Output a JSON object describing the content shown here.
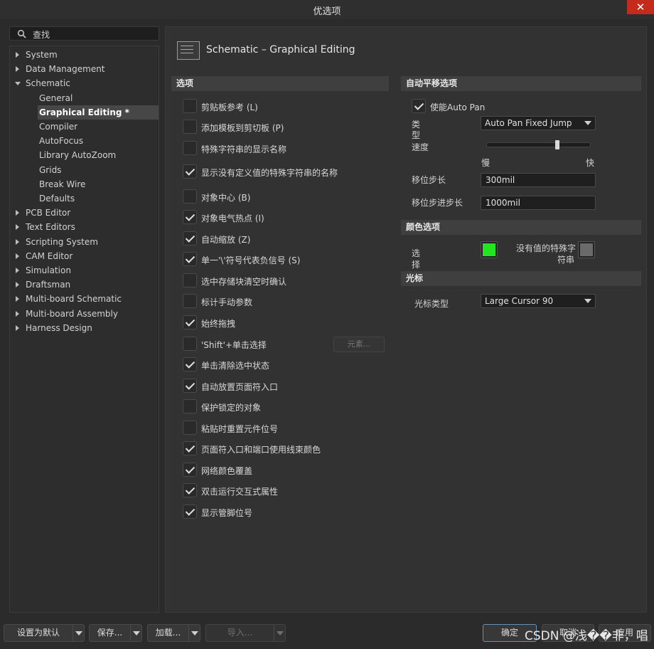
{
  "window": {
    "title": "优选项",
    "close_glyph": "✕"
  },
  "search": {
    "placeholder": "查找"
  },
  "tree": {
    "items": [
      {
        "label": "System",
        "expanded": false
      },
      {
        "label": "Data Management",
        "expanded": false
      },
      {
        "label": "Schematic",
        "expanded": true
      },
      {
        "label": "General",
        "child": true
      },
      {
        "label": "Graphical Editing *",
        "child": true,
        "selected": true
      },
      {
        "label": "Compiler",
        "child": true
      },
      {
        "label": "AutoFocus",
        "child": true
      },
      {
        "label": "Library AutoZoom",
        "child": true
      },
      {
        "label": "Grids",
        "child": true
      },
      {
        "label": "Break Wire",
        "child": true
      },
      {
        "label": "Defaults",
        "child": true
      },
      {
        "label": "PCB Editor",
        "expanded": false
      },
      {
        "label": "Text Editors",
        "expanded": false
      },
      {
        "label": "Scripting System",
        "expanded": false
      },
      {
        "label": "CAM Editor",
        "expanded": false
      },
      {
        "label": "Simulation",
        "expanded": false
      },
      {
        "label": "Draftsman",
        "expanded": false
      },
      {
        "label": "Multi-board Schematic",
        "expanded": false
      },
      {
        "label": "Multi-board Assembly",
        "expanded": false
      },
      {
        "label": "Harness Design",
        "expanded": false
      }
    ]
  },
  "page": {
    "title": "Schematic – Graphical Editing"
  },
  "options": {
    "header": "选项",
    "items": [
      {
        "label": "剪贴板参考 (L)",
        "checked": false
      },
      {
        "label": "添加模板到剪切板 (P)",
        "checked": false
      },
      {
        "label": "特殊字符串的显示名称",
        "checked": false
      },
      {
        "label": "显示没有定义值的特殊字符串的名称",
        "checked": true
      },
      {
        "label": "对象中心 (B)",
        "checked": false
      },
      {
        "label": "对象电气热点 (I)",
        "checked": true
      },
      {
        "label": "自动缩放 (Z)",
        "checked": true
      },
      {
        "label": "单一'\\'符号代表负信号 (S)",
        "checked": true
      },
      {
        "label": "选中存储块清空时确认",
        "checked": false
      },
      {
        "label": "标计手动参数",
        "checked": false
      },
      {
        "label": "始终拖拽",
        "checked": true
      },
      {
        "label": "'Shift'+单击选择",
        "checked": false
      },
      {
        "label": "单击清除选中状态",
        "checked": true
      },
      {
        "label": "自动放置页面符入口",
        "checked": true
      },
      {
        "label": "保护锁定的对象",
        "checked": false
      },
      {
        "label": "粘贴时重置元件位号",
        "checked": false
      },
      {
        "label": "页面符入口和端口使用线束颜色",
        "checked": true
      },
      {
        "label": "网络颜色覆盖",
        "checked": true
      },
      {
        "label": "双击运行交互式属性",
        "checked": true
      },
      {
        "label": "显示管脚位号",
        "checked": true
      }
    ],
    "elements_button": "元素..."
  },
  "autopan": {
    "header": "自动平移选项",
    "enable_label": "使能Auto Pan",
    "enable_checked": true,
    "type_label": "类\n型",
    "type_label_top": "类",
    "type_label_bottom": "型",
    "type_value": "Auto Pan Fixed Jump",
    "speed_label": "速度",
    "speed_slow": "慢",
    "speed_fast": "快",
    "speed_level_fraction": 0.68,
    "step_label": "移位步长",
    "step_value": "300mil",
    "shift_step_label": "移位步进步长",
    "shift_step_value": "1000mil"
  },
  "colors": {
    "header": "颜色选项",
    "select_top": "选",
    "select_bottom": "择",
    "select_color": "#22e622",
    "nostr_line1": "没有值的特殊字",
    "nostr_line2": "符串",
    "nostr_color": "#6a6a6a"
  },
  "cursor": {
    "header": "光标",
    "type_label": "光标类型",
    "type_value": "Large Cursor 90"
  },
  "footer": {
    "set_default": "设置为默认",
    "save": "保存...",
    "load": "加载...",
    "import": "导入...",
    "ok": "确定",
    "cancel": "取消",
    "apply": "应用"
  },
  "watermark": "CSDN @浅��非，唱"
}
